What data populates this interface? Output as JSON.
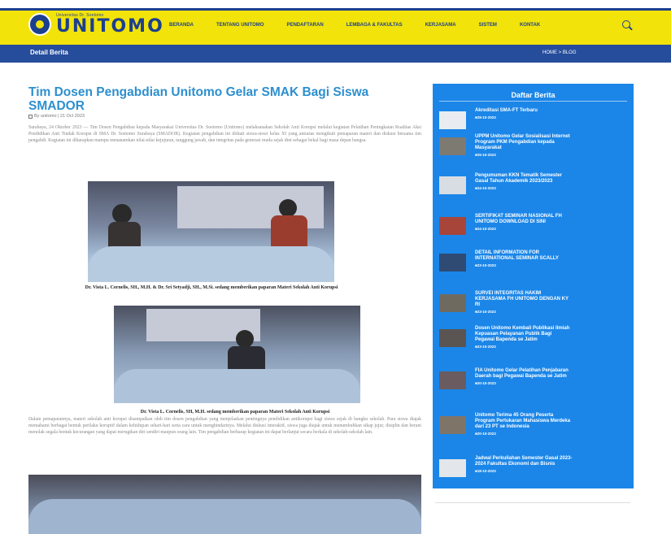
{
  "header": {
    "logo_tagline": "Universitas Dr. Soetomo",
    "logo_text": "UNITOMO",
    "nav": [
      "BERANDA",
      "TENTANG UNITOMO",
      "PENDAFTARAN",
      "LEMBAGA & FAKULTAS",
      "KERJASAMA",
      "SISTEM",
      "KONTAK"
    ]
  },
  "banner": {
    "title": "Detail Berita",
    "breadcrumb": "HOME > BLOG"
  },
  "article": {
    "title": "Tim Dosen Pengabdian Unitomo Gelar SMAK Bagi Siswa SMADOR",
    "meta": "By unitomo | 21 Oct 2023",
    "para1": "Surabaya, 24 Oktober 2023 — Tim Dosen Pengabdian kepada Masyarakat Universitas Dr. Soetomo (Unitomo) melaksanakan Sekolah Anti Korupsi melalui kegiatan Pelatihan Peningkatan Kualitas Aksi Pendidikan Anti Tindak Korupsi di SMA Dr. Soetomo Surabaya (SMADOR). Kegiatan pengabdian ini diikuti siswa-siswi kelas XI yang antusias mengikuti pemaparan materi dan diskusi bersama tim pengabdi. Kegiatan ini diharapkan mampu menanamkan nilai-nilai kejujuran, tanggung jawab, dan integritas pada generasi muda sejak dini sebagai bekal bagi masa depan bangsa.",
    "caption1": "Dr. Vista L. Cornelis, SH., M.H. & Dr. Sri Setyadji, SH., M.Si. sedang memberikan paparan Materi Sekolah Anti Korupsi",
    "caption2": "Dr. Vista L. Cornelis, SH, M.H. sedang memberikan paparan Materi Sekolah Anti Korupsi",
    "para2": "Dalam pemaparannya, materi sekolah anti korupsi disampaikan oleh tim dosen pengabdian yang menjelaskan pentingnya pendidikan antikorupsi bagi siswa sejak di bangku sekolah. Para siswa diajak memahami berbagai bentuk perilaku koruptif dalam kehidupan sehari-hari serta cara untuk menghindarinya. Melalui diskusi interaktif, siswa juga diajak untuk menumbuhkan sikap jujur, disiplin dan berani menolak segala bentuk kecurangan yang dapat merugikan diri sendiri maupun orang lain. Tim pengabdian berharap kegiatan ini dapat berlanjut secara berkala di sekolah-sekolah lain."
  },
  "sidebar": {
    "title": "Daftar Berita",
    "items": [
      {
        "title": "Akreditasi SMA-FT Terbaru",
        "date": "28-10-2023"
      },
      {
        "title": "UPPM Unitomo Gelar Sosialisasi Internet Program PKM Pengabdian kepada Masyarakat",
        "date": "25-10-2023"
      },
      {
        "title": "Pengumuman KKN Tematik Semester Gasal Tahun Akademik 2023/2023",
        "date": "24-10-2023"
      },
      {
        "title": "SERTIFIKAT SEMINAR NASIONAL FH UNITOMO DOWNLOAD DI SINI",
        "date": "24-10-2023"
      },
      {
        "title": "DETAIL INFORMATION FOR INTERNATIONAL SEMINAR SCALLY",
        "date": "23-10-2023"
      },
      {
        "title": "SURVEI INTEGRITAS HAKIM KERJASAMA FH UNITOMO DENGAN KY RI",
        "date": "23-10-2023"
      },
      {
        "title": "Dosen Unitomo Kembali Publikasi Ilmiah Kepuasan Pelayanan Publik Bagi Pegawai Bapenda se Jatim",
        "date": "23-10-2023"
      },
      {
        "title": "FIA Unitomo Gelar Pelatihan Penjabaran Daerah bagi Pegawai Bapenda se Jatim",
        "date": "20-10-2023"
      },
      {
        "title": "Unitomo Terima 45 Orang Peserta Program Pertukaran Mahasiswa Merdeka dari 23 PT se Indonesia",
        "date": "20-10-2023"
      },
      {
        "title": "Jadwal Perkuliahan Semester Gasal 2023-2024 Fakultas Ekonomi dan Bisnis",
        "date": "18-10-2023"
      }
    ]
  }
}
